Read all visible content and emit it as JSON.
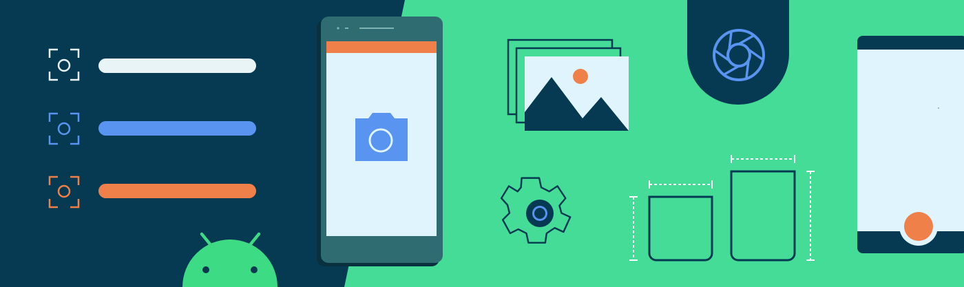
{
  "banner": {
    "theme": "android-camera-illustration",
    "colors": {
      "navy": "#053a52",
      "green": "#45dc97",
      "android_green": "#3ddc84",
      "light_blue": "#e0f4fd",
      "blue": "#5894f0",
      "orange": "#f0804a",
      "white": "#ffffff",
      "phone_body": "#2f6c72"
    },
    "focus_rows": [
      {
        "icon": "focus-frame-icon",
        "color": "#e8f4f6"
      },
      {
        "icon": "focus-frame-icon",
        "color": "#5894f0"
      },
      {
        "icon": "focus-frame-icon",
        "color": "#f0804a"
      }
    ],
    "icons": [
      "camera-icon",
      "image-gallery-icon",
      "aperture-icon",
      "settings-gear-icon",
      "android-logo-icon",
      "dimension-frames-icon",
      "capture-button-icon"
    ]
  }
}
